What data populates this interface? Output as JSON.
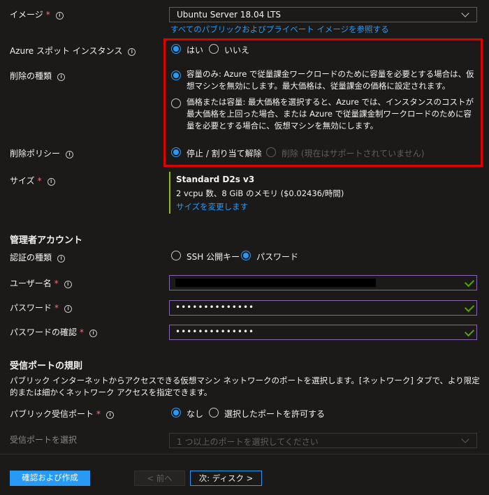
{
  "image": {
    "label": "イメージ",
    "value": "Ubuntu Server 18.04 LTS",
    "link": "すべてのパブリックおよびプライベート イメージを参照する"
  },
  "spot": {
    "label": "Azure スポット インスタンス",
    "yes": "はい",
    "no": "いいえ"
  },
  "eviction_type": {
    "label": "削除の種類",
    "opt1": "容量のみ: Azure で従量課金ワークロードのために容量を必要とする場合は、仮想マシンを無効にします。最大価格は、従量課金の価格に設定されます。",
    "opt2": "価格または容量: 最大価格を選択すると、Azure では、インスタンスのコストが最大価格を上回った場合、または Azure で従量課金制ワークロードのために容量を必要とする場合に、仮想マシンを無効にします。"
  },
  "eviction_policy": {
    "label": "削除ポリシー",
    "opt1": "停止 / 割り当て解除",
    "opt2": "削除 (現在はサポートされていません)"
  },
  "size": {
    "label": "サイズ",
    "name": "Standard D2s v3",
    "detail": "2 vcpu 数、8 GiB のメモリ ($0.02436/時間)",
    "link": "サイズを変更します"
  },
  "admin": {
    "title": "管理者アカウント",
    "auth_label": "認証の種類",
    "auth_ssh": "SSH 公開キー",
    "auth_pwd": "パスワード",
    "user_label": "ユーザー名",
    "pwd_label": "パスワード",
    "pwd_value": "••••••••••••••",
    "confirm_label": "パスワードの確認",
    "confirm_value": "••••••••••••••"
  },
  "inbound": {
    "title": "受信ポートの規則",
    "desc": "パブリック インターネットからアクセスできる仮想マシン ネットワークのポートを選択します。[ネットワーク] タブで、より限定的または細かくネットワーク アクセスを指定できます。",
    "public_label": "パブリック受信ポート",
    "none": "なし",
    "allow": "選択したポートを許可する",
    "select_label": "受信ポートを選択",
    "select_placeholder": "1 つ以上のポートを選択してください"
  },
  "footer": {
    "review": "確認および作成",
    "prev": "< 前へ",
    "next": "次: ディスク >"
  },
  "colors": {
    "accent": "#2899f5",
    "highlight": "#e00000",
    "valid": "#57a300"
  }
}
